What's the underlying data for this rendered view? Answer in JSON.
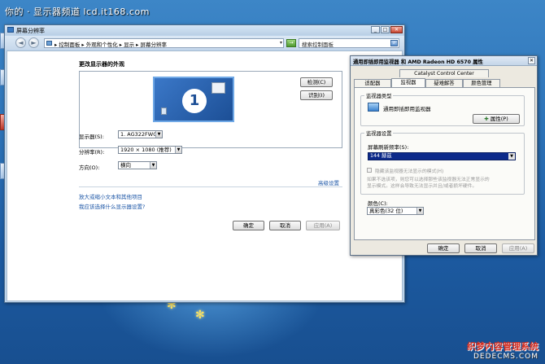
{
  "watermark": {
    "top": "你的 · 显示器频道 lcd.it168.com",
    "brand": "织梦内容管理系统",
    "brand_url": "DEDECMS.COM"
  },
  "main_window": {
    "title": "屏幕分辨率",
    "caption_buttons": {
      "minimize": "_",
      "maximize": "□",
      "close": "✕"
    },
    "nav": {
      "back": "◄",
      "forward": "►"
    },
    "address": {
      "crumbs": "▸ 控制面板 ▸ 外观和个性化 ▸ 显示 ▸ 屏幕分辨率",
      "go": "→"
    },
    "search": {
      "placeholder": "搜索控制面板",
      "icon_glyph": "⌕"
    },
    "heading": "更改显示器的外观",
    "monitor_number": "1",
    "detect_button": "检测(C)",
    "identify_button": "识别(I)",
    "display_label": "显示器(S):",
    "display_value": "1. AG322FWG4",
    "resolution_label": "分辨率(R):",
    "resolution_value": "1920 × 1080 (推荐)",
    "orientation_label": "方向(O):",
    "orientation_value": "横向",
    "advanced_link": "高级设置",
    "link_text_size": "放大或缩小文本和其他项目",
    "link_which_settings": "我应该选择什么显示器设置?",
    "ok_button": "确定",
    "cancel_button": "取消",
    "apply_button": "应用(A)"
  },
  "dialog": {
    "title": "通用即插即用监视器 和 AMD Radeon HD 6570 属性",
    "close_glyph": "✕",
    "tabs_row1": [
      {
        "label": "Catalyst Control Center"
      }
    ],
    "tabs_row2": [
      {
        "label": "适配器"
      },
      {
        "label": "监视器"
      },
      {
        "label": "疑难解答"
      },
      {
        "label": "颜色管理"
      }
    ],
    "monitor_type_group": "监视器类型",
    "monitor_type_value": "通用即插即用监视器",
    "properties_button": "属性(P)",
    "monitor_settings_group": "监视器设置",
    "refresh_label": "屏幕刷新频率(S):",
    "refresh_value": "144 赫兹",
    "hide_modes_label": "隐藏该监视器无法显示的模式(H)",
    "hide_modes_desc_1": "如果不选该项，则您可以选择那些该监视器无法正常显示的",
    "hide_modes_desc_2": "显示模式。这样会导致无法显示并且/或者损坏硬件。",
    "colors_label": "颜色(C):",
    "colors_value": "真彩色(32 位)",
    "ok_button": "确定",
    "cancel_button": "取消",
    "apply_button": "应用(A)"
  },
  "icons": [
    "window-icon",
    "back-arrow-icon",
    "forward-arrow-icon",
    "control-panel-icon",
    "search-icon",
    "go-arrow-icon",
    "monitor-icon",
    "properties-icon",
    "dropdown-arrow-icon"
  ],
  "colors": {
    "desktop": "#2d73b8",
    "selection": "#0c2a8a",
    "link": "#1b55a6"
  }
}
